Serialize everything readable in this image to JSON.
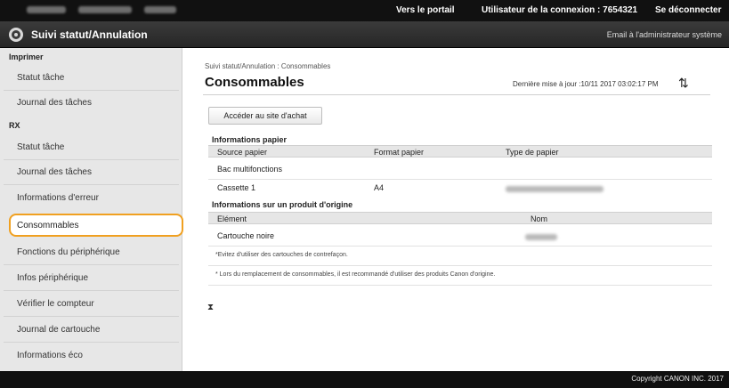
{
  "topbar": {
    "portal_link": "Vers le portail",
    "user_label": "Utilisateur de la connexion : 7654321",
    "logout_link": "Se déconnecter"
  },
  "titlebar": {
    "app_title": "Suivi statut/Annulation",
    "admin_email_link": "Email à l'administrateur système"
  },
  "sidebar": {
    "sections": [
      {
        "heading": "Imprimer",
        "items": [
          {
            "label": "Statut tâche"
          },
          {
            "label": "Journal des tâches"
          }
        ]
      },
      {
        "heading": "RX",
        "items": [
          {
            "label": "Statut tâche"
          },
          {
            "label": "Journal des tâches"
          }
        ]
      }
    ],
    "items": [
      {
        "label": "Informations d'erreur"
      },
      {
        "label": "Consommables",
        "active": true
      },
      {
        "label": "Fonctions du périphérique"
      },
      {
        "label": "Infos périphérique"
      },
      {
        "label": "Vérifier le compteur"
      },
      {
        "label": "Journal de cartouche"
      },
      {
        "label": "Informations éco"
      }
    ],
    "active_color": "#f0a020"
  },
  "main": {
    "breadcrumb": "Suivi statut/Annulation : Consommables",
    "title": "Consommables",
    "last_updated": "Dernière mise à jour :10/11 2017 03:02:17 PM",
    "buy_site_button": "Accéder au site d'achat",
    "paper_info": {
      "heading": "Informations papier",
      "columns": [
        "Source papier",
        "Format papier",
        "Type de papier"
      ],
      "rows": [
        {
          "source": "Bac multifonctions",
          "format": "",
          "type": ""
        },
        {
          "source": "Cassette 1",
          "format": "A4",
          "type": ""
        }
      ]
    },
    "genuine_info": {
      "heading": "Informations sur un produit d'origine",
      "columns": [
        "Elément",
        "Nom"
      ],
      "rows": [
        {
          "element": "Cartouche noire",
          "name": ""
        }
      ]
    },
    "notes": [
      "*Evitez d'utiliser des cartouches de contrefaçon.",
      "* Lors du remplacement de consommables, il est recommandé d'utiliser des produits Canon d'origine."
    ]
  },
  "footer": {
    "copyright": "Copyright CANON INC. 2017"
  }
}
